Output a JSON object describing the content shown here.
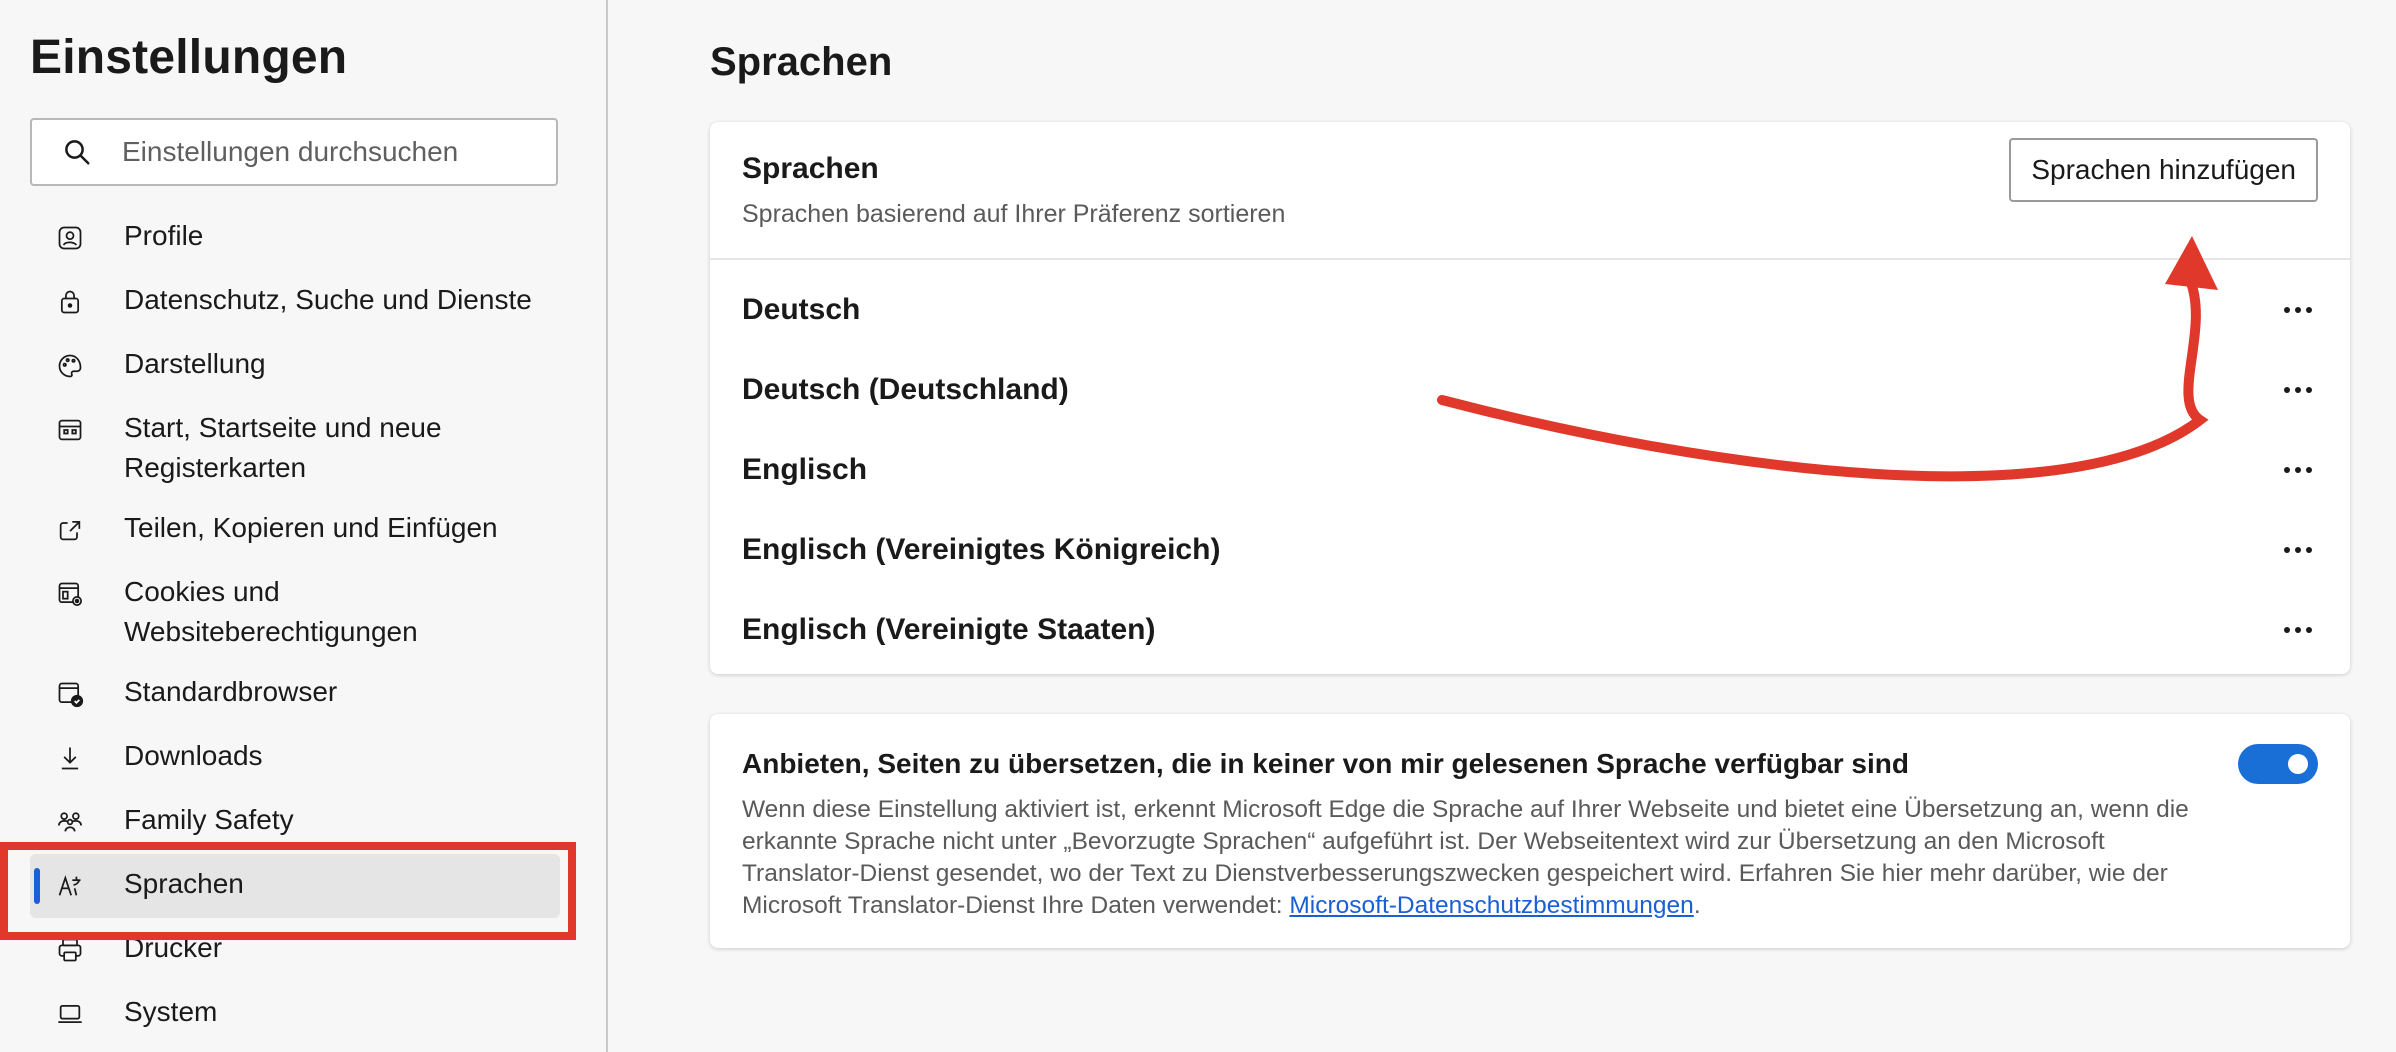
{
  "sidebar": {
    "title": "Einstellungen",
    "search": {
      "placeholder": "Einstellungen durchsuchen",
      "icon": "search-icon"
    },
    "items": [
      {
        "label": "Profile",
        "icon": "profile-icon"
      },
      {
        "label": "Datenschutz, Suche und Dienste",
        "icon": "lock-icon"
      },
      {
        "label": "Darstellung",
        "icon": "palette-icon"
      },
      {
        "label": "Start, Startseite und neue Registerkarten",
        "icon": "home-tabs-icon"
      },
      {
        "label": "Teilen, Kopieren und Einfügen",
        "icon": "share-icon"
      },
      {
        "label": "Cookies und Websiteberechtigungen",
        "icon": "cookies-icon"
      },
      {
        "label": "Standardbrowser",
        "icon": "default-browser-icon"
      },
      {
        "label": "Downloads",
        "icon": "download-icon"
      },
      {
        "label": "Family Safety",
        "icon": "family-icon"
      },
      {
        "label": "Sprachen",
        "icon": "languages-icon",
        "active": true
      },
      {
        "label": "Drucker",
        "icon": "printer-icon"
      },
      {
        "label": "System",
        "icon": "laptop-icon"
      }
    ]
  },
  "main": {
    "title": "Sprachen",
    "languages_card": {
      "title": "Sprachen",
      "subtitle": "Sprachen basierend auf Ihrer Präferenz sortieren",
      "add_button": "Sprachen hinzufügen",
      "languages": [
        "Deutsch",
        "Deutsch (Deutschland)",
        "Englisch",
        "Englisch (Vereinigtes Königreich)",
        "Englisch (Vereinigte Staaten)"
      ]
    },
    "translate_card": {
      "title": "Anbieten, Seiten zu übersetzen, die in keiner von mir gelesenen Sprache verfügbar sind",
      "description": "Wenn diese Einstellung aktiviert ist, erkennt Microsoft Edge die Sprache auf Ihrer Webseite und bietet eine Übersetzung an, wenn die erkannte Sprache nicht unter „Bevorzugte Sprachen“ aufgeführt ist. Der Webseitentext wird zur Übersetzung an den Microsoft Translator-Dienst gesendet, wo der Text zu Dienstverbesserungszwecken gespeichert wird. Erfahren Sie hier mehr darüber, wie der Microsoft Translator-Dienst Ihre Daten verwendet: ",
      "link": "Microsoft-Datenschutzbestimmungen",
      "after_link": ".",
      "toggle_on": true
    }
  },
  "colors": {
    "accent": "#1a6fd6",
    "annotation": "#e0382a",
    "link": "#1a5fd6"
  }
}
